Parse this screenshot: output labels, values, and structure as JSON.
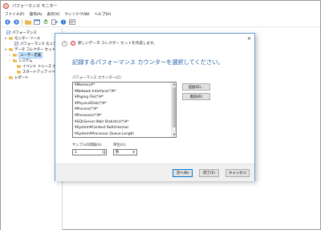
{
  "app": {
    "title": "パフォーマンス モニター",
    "colors": {
      "accent": "#1f5fa8",
      "selection": "#cce8ff"
    }
  },
  "menubar": {
    "items": [
      "ファイル(F)",
      "操作(A)",
      "表示(V)",
      "ウィンドウ(W)",
      "ヘルプ(H)"
    ]
  },
  "toolbar": {
    "buttons": [
      "back-icon",
      "forward-icon",
      "folder-icon",
      "console-icon",
      "refresh-icon",
      "export-icon",
      "help-icon",
      "properties-icon"
    ]
  },
  "tree": {
    "items": [
      {
        "label": "パフォーマンス",
        "icon": "performance-icon",
        "level": 0,
        "expander": ""
      },
      {
        "label": "モニター ツール",
        "icon": "folder-icon",
        "level": 1,
        "expander": "▾"
      },
      {
        "label": "パフォーマンス モニター",
        "icon": "chart-icon",
        "level": 2,
        "expander": ""
      },
      {
        "label": "データ コレクター セット",
        "icon": "folder-icon",
        "level": 1,
        "expander": "▾"
      },
      {
        "label": "ユーザー定義",
        "icon": "folder-icon",
        "level": 2,
        "expander": "›",
        "selected": true
      },
      {
        "label": "システム",
        "icon": "folder-icon",
        "level": 2,
        "expander": "›"
      },
      {
        "label": "イベント トレース セッシ",
        "icon": "folder-icon",
        "level": 2,
        "expander": ""
      },
      {
        "label": "スタートアップ イベント",
        "icon": "folder-icon",
        "level": 2,
        "expander": ""
      },
      {
        "label": "レポート",
        "icon": "folder-icon",
        "level": 1,
        "expander": "›"
      }
    ]
  },
  "dialog": {
    "title": "新しいデータ コレクター セットを作成します。",
    "close_label": "✕",
    "heading": "記録するパフォーマンス カウンターを選択してください。",
    "counters_label": "パフォーマンス カウンター(C):",
    "counters": [
      "¥Memory¥*",
      "¥Network Interface(*)¥*",
      "¥Paging File(*)¥*",
      "¥PhysicalDisk(*)¥*",
      "¥Process(*)¥*",
      "¥Processor(*)¥*",
      "¥SQLServer:Wait Statistics(*)¥*",
      "¥System¥Context Switches/sec",
      "¥System¥Processor Queue Length"
    ],
    "add_label": "追加(D)...",
    "remove_label": "削除(R)",
    "interval_label": "サンプルの間隔(S):",
    "interval_value": "1",
    "units_label": "単位(U):",
    "units_value": "秒",
    "next_label": "次へ(N)",
    "finish_label": "完了(F)",
    "cancel_label": "キャンセル"
  }
}
